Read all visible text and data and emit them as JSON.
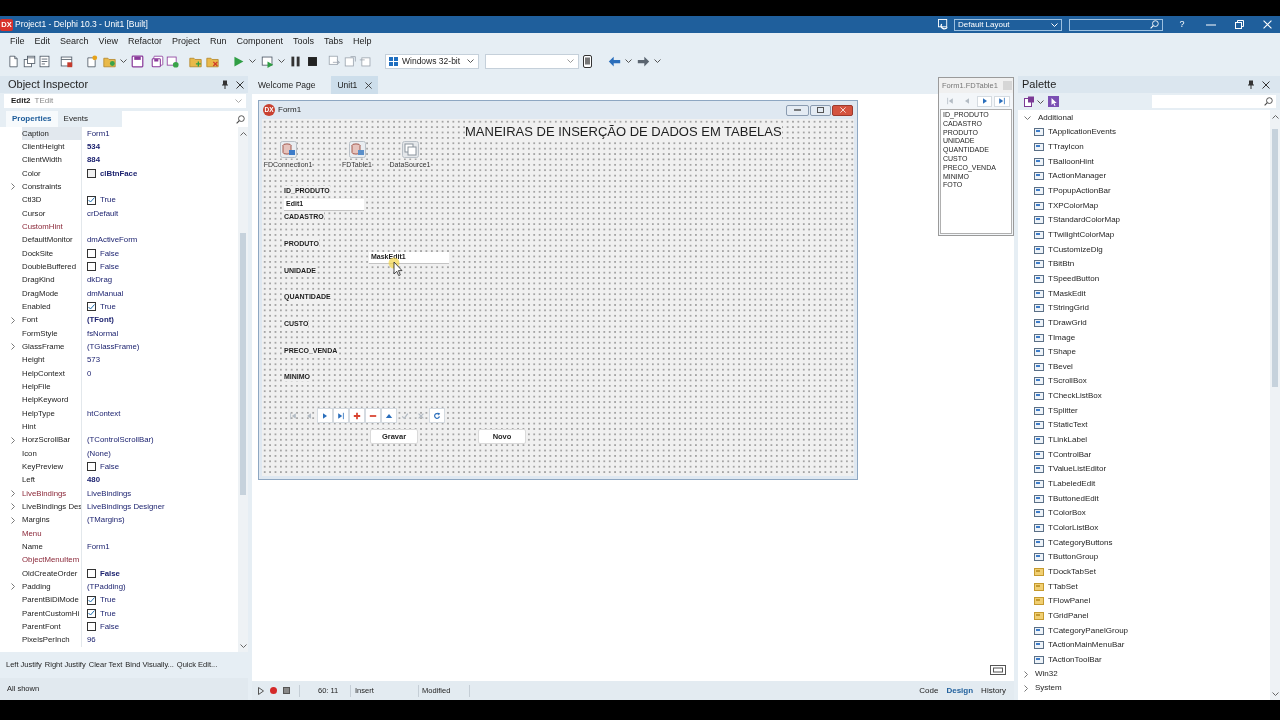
{
  "window": {
    "logo": "DX",
    "title": "Project1 - Delphi 10.3 - Unit1 [Built]",
    "layout": "Default Layout",
    "help": "?"
  },
  "menu": [
    "File",
    "Edit",
    "Search",
    "View",
    "Refactor",
    "Project",
    "Run",
    "Component",
    "Tools",
    "Tabs",
    "Help"
  ],
  "toolbar": {
    "platform": "Windows 32-bit"
  },
  "object_inspector": {
    "title": "Object Inspector",
    "component": "Edit2",
    "component_type": "TEdit",
    "tabs": [
      {
        "label": "Properties",
        "selected": true
      },
      {
        "label": "Events",
        "selected": false
      }
    ],
    "properties": [
      {
        "name": "Caption",
        "kind": "text",
        "value": "Form1",
        "selected": true
      },
      {
        "name": "ClientHeight",
        "kind": "text",
        "value": "534",
        "modified": true,
        "selected": false
      },
      {
        "name": "ClientWidth",
        "kind": "text",
        "value": "884",
        "modified": true,
        "selected": false
      },
      {
        "name": "Color",
        "kind": "color",
        "color": "#f0f0f0",
        "value": "clBtnFace",
        "modified": true,
        "selected": false
      },
      {
        "name": "Constraints",
        "kind": "text",
        "expandable": true,
        "selected": false
      },
      {
        "name": "Ctl3D",
        "kind": "checkbox",
        "checked": true,
        "value": "True",
        "selected": false
      },
      {
        "name": "Cursor",
        "kind": "text",
        "value": "crDefault",
        "selected": false
      },
      {
        "name": "CustomHint",
        "kind": "text",
        "reference": true,
        "selected": false
      },
      {
        "name": "DefaultMonitor",
        "kind": "text",
        "value": "dmActiveForm",
        "selected": false
      },
      {
        "name": "DockSite",
        "kind": "checkbox",
        "checked": false,
        "value": "False",
        "selected": false
      },
      {
        "name": "DoubleBuffered",
        "kind": "checkbox",
        "checked": false,
        "value": "False",
        "selected": false
      },
      {
        "name": "DragKind",
        "kind": "text",
        "value": "dkDrag",
        "selected": false
      },
      {
        "name": "DragMode",
        "kind": "text",
        "value": "dmManual",
        "selected": false
      },
      {
        "name": "Enabled",
        "kind": "checkbox",
        "checked": true,
        "value": "True",
        "selected": false
      },
      {
        "name": "Font",
        "kind": "text",
        "value": "(TFont)",
        "expandable": true,
        "modified": true,
        "selected": false
      },
      {
        "name": "FormStyle",
        "kind": "text",
        "value": "fsNormal",
        "selected": false
      },
      {
        "name": "GlassFrame",
        "kind": "text",
        "value": "(TGlassFrame)",
        "expandable": true,
        "selected": false
      },
      {
        "name": "Height",
        "kind": "text",
        "value": "573",
        "selected": false
      },
      {
        "name": "HelpContext",
        "kind": "text",
        "value": "0",
        "selected": false
      },
      {
        "name": "HelpFile",
        "kind": "text",
        "selected": false
      },
      {
        "name": "HelpKeyword",
        "kind": "text",
        "selected": false
      },
      {
        "name": "HelpType",
        "kind": "text",
        "value": "htContext",
        "selected": false
      },
      {
        "name": "Hint",
        "kind": "text",
        "selected": false
      },
      {
        "name": "HorzScrollBar",
        "kind": "text",
        "value": "(TControlScrollBar)",
        "expandable": true,
        "selected": false
      },
      {
        "name": "Icon",
        "kind": "text",
        "value": "(None)",
        "selected": false
      },
      {
        "name": "KeyPreview",
        "kind": "checkbox",
        "checked": false,
        "value": "False",
        "selected": false
      },
      {
        "name": "Left",
        "kind": "text",
        "value": "480",
        "modified": true,
        "selected": false
      },
      {
        "name": "LiveBindings",
        "kind": "text",
        "value": "LiveBindings",
        "expandable": true,
        "reference": true,
        "selected": false
      },
      {
        "name": "LiveBindings Des",
        "kind": "text",
        "value": "LiveBindings Designer",
        "expandable": true,
        "selected": false
      },
      {
        "name": "Margins",
        "kind": "text",
        "value": "(TMargins)",
        "expandable": true,
        "selected": false
      },
      {
        "name": "Menu",
        "kind": "text",
        "reference": true,
        "selected": false
      },
      {
        "name": "Name",
        "kind": "text",
        "value": "Form1",
        "selected": false
      },
      {
        "name": "ObjectMenuItem",
        "kind": "text",
        "reference": true,
        "selected": false
      },
      {
        "name": "OldCreateOrder",
        "kind": "checkbox",
        "checked": false,
        "value": "False",
        "modified": true,
        "selected": false
      },
      {
        "name": "Padding",
        "kind": "text",
        "value": "(TPadding)",
        "expandable": true,
        "selected": false
      },
      {
        "name": "ParentBiDiMode",
        "kind": "checkbox",
        "checked": true,
        "value": "True",
        "selected": false
      },
      {
        "name": "ParentCustomHi",
        "kind": "checkbox",
        "checked": true,
        "value": "True",
        "selected": false
      },
      {
        "name": "ParentFont",
        "kind": "checkbox",
        "checked": false,
        "value": "False",
        "selected": false
      },
      {
        "name": "PixelsPerInch",
        "kind": "text",
        "value": "96",
        "selected": false
      }
    ],
    "actions": [
      "Left Justify",
      "Right Justify",
      "Clear Text",
      "Bind Visually...",
      "Quick Edit..."
    ],
    "status": "All shown"
  },
  "editor_tabs": [
    {
      "label": "Welcome Page",
      "selected": false
    },
    {
      "label": "Unit1",
      "selected": true
    }
  ],
  "form": {
    "logo": "DX",
    "title": "Form1",
    "heading": "MANEIRAS DE INSERÇÃO DE DADOS EM TABELAS",
    "components": [
      "FDConnection1",
      "FDTable1",
      "DataSource1"
    ],
    "labels": [
      "ID_PRODUTO",
      "CADASTRO",
      "PRODUTO",
      "UNIDADE",
      "QUANTIDADE",
      "CUSTO",
      "PRECO_VENDA",
      "MINIMO"
    ],
    "edit": "Edit1",
    "mask_edit": "MaskEdit1",
    "navigator": [
      {
        "disabled": true
      },
      {
        "disabled": true
      },
      {
        "disabled": false
      },
      {
        "disabled": false
      },
      {
        "disabled": false
      },
      {
        "disabled": false
      },
      {
        "disabled": false
      },
      {
        "disabled": true
      },
      {
        "disabled": true
      },
      {
        "disabled": false
      }
    ],
    "buttons": [
      "Gravar",
      "Novo"
    ]
  },
  "field_editor": {
    "title": "Form1.FDTable1",
    "navigator": [
      {
        "disabled": true
      },
      {
        "disabled": true
      },
      {
        "disabled": false
      },
      {
        "disabled": false
      }
    ],
    "fields": [
      "ID_PRODUTO",
      "CADASTRO",
      "PRODUTO",
      "UNIDADE",
      "QUANTIDADE",
      "CUSTO",
      "PRECO_VENDA",
      "MINIMO",
      "FOTO"
    ]
  },
  "status_bar": {
    "position": "60: 11",
    "mode": "Insert",
    "state": "Modified",
    "views": [
      {
        "label": "Code",
        "selected": false
      },
      {
        "label": "Design",
        "selected": true
      },
      {
        "label": "History",
        "selected": false
      }
    ]
  },
  "palette": {
    "title": "Palette",
    "groups": [
      {
        "label": "Additional",
        "expanded": true,
        "children": [
          "TApplicationEvents",
          "TTrayIcon",
          "TBalloonHint",
          "TActionManager",
          "TPopupActionBar",
          "TXPColorMap",
          "TStandardColorMap",
          "TTwilightColorMap",
          "TCustomizeDlg",
          "TBitBtn",
          "TSpeedButton",
          "TMaskEdit",
          "TStringGrid",
          "TDrawGrid",
          "TImage",
          "TShape",
          "TBevel",
          "TScrollBox",
          "TCheckListBox",
          "TSplitter",
          "TStaticText",
          "TLinkLabel",
          "TControlBar",
          "TValueListEditor",
          "TLabeledEdit",
          "TButtonedEdit",
          "TColorBox",
          "TColorListBox",
          "TCategoryButtons",
          "TButtonGroup",
          "TDockTabSet",
          "TTabSet",
          "TFlowPanel",
          "TGridPanel",
          "TCategoryPanelGroup",
          "TActionMainMenuBar",
          "TActionToolBar"
        ]
      },
      {
        "label": "Win32",
        "expanded": false
      },
      {
        "label": "System",
        "expanded": false
      }
    ]
  }
}
